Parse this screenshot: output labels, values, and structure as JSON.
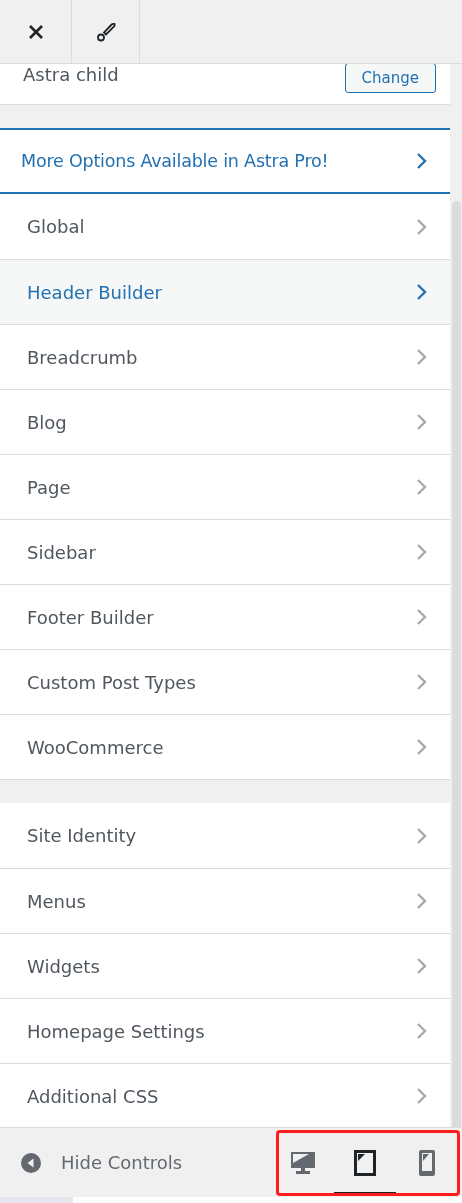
{
  "header": {
    "buttons": [
      {
        "kind": "close"
      },
      {
        "kind": "brush"
      }
    ]
  },
  "theme": {
    "name": "Astra child",
    "button": "Change"
  },
  "promo": {
    "label": "More Options Available in Astra Pro!"
  },
  "sections": [
    {
      "items": [
        {
          "label": "Global",
          "selected": false
        },
        {
          "label": "Header Builder",
          "selected": true
        },
        {
          "label": "Breadcrumb",
          "selected": false
        },
        {
          "label": "Blog",
          "selected": false
        },
        {
          "label": "Page",
          "selected": false
        },
        {
          "label": "Sidebar",
          "selected": false
        },
        {
          "label": "Footer Builder",
          "selected": false
        },
        {
          "label": "Custom Post Types",
          "selected": false
        },
        {
          "label": "WooCommerce",
          "selected": false
        }
      ]
    },
    {
      "items": [
        {
          "label": "Site Identity",
          "selected": false
        },
        {
          "label": "Menus",
          "selected": false
        },
        {
          "label": "Widgets",
          "selected": false
        },
        {
          "label": "Homepage Settings",
          "selected": false
        },
        {
          "label": "Additional CSS",
          "selected": false
        }
      ]
    }
  ],
  "footer": {
    "hide_controls": "Hide Controls",
    "devices": [
      {
        "kind": "desktop",
        "selected": false
      },
      {
        "kind": "tablet",
        "selected": true
      },
      {
        "kind": "mobile",
        "selected": false
      }
    ]
  }
}
